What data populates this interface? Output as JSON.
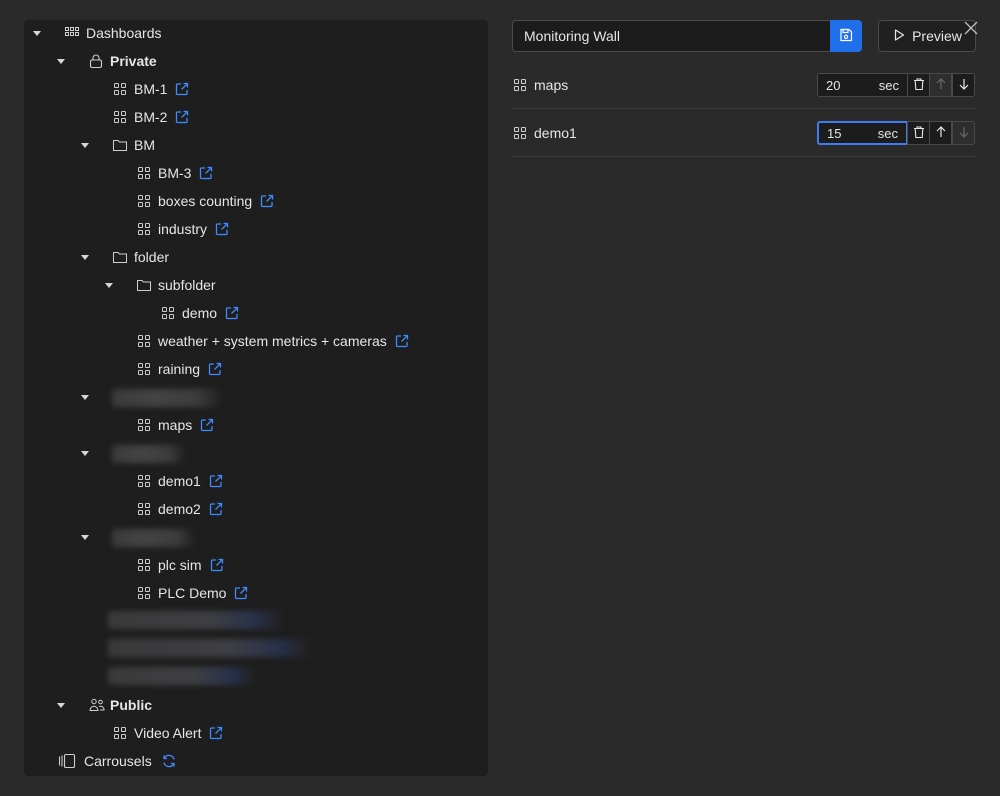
{
  "tree": {
    "root_label": "Dashboards",
    "private_label": "Private",
    "items": {
      "bm1": "BM-1",
      "bm2": "BM-2",
      "bm_folder": "BM",
      "bm3": "BM-3",
      "boxes_counting": "boxes counting",
      "industry": "industry",
      "folder": "folder",
      "subfolder": "subfolder",
      "demo": "demo",
      "weather": "weather + system metrics + cameras",
      "raining": "raining",
      "maps": "maps",
      "demo1": "demo1",
      "demo2": "demo2",
      "plc_sim": "plc sim",
      "plc_demo": "PLC Demo"
    },
    "public_label": "Public",
    "video_alert": "Video Alert",
    "carrousels_label": "Carrousels"
  },
  "editor": {
    "name_value": "Monitoring Wall",
    "preview_label": "Preview",
    "items": [
      {
        "name": "maps",
        "seconds": "20",
        "unit": "sec"
      },
      {
        "name": "demo1",
        "seconds": "15",
        "unit": "sec"
      }
    ]
  },
  "colors": {
    "accent": "#1f6feb",
    "link_icon": "#3d8bfd",
    "panel": "#1e1e1e",
    "background": "#2a2a2a"
  }
}
